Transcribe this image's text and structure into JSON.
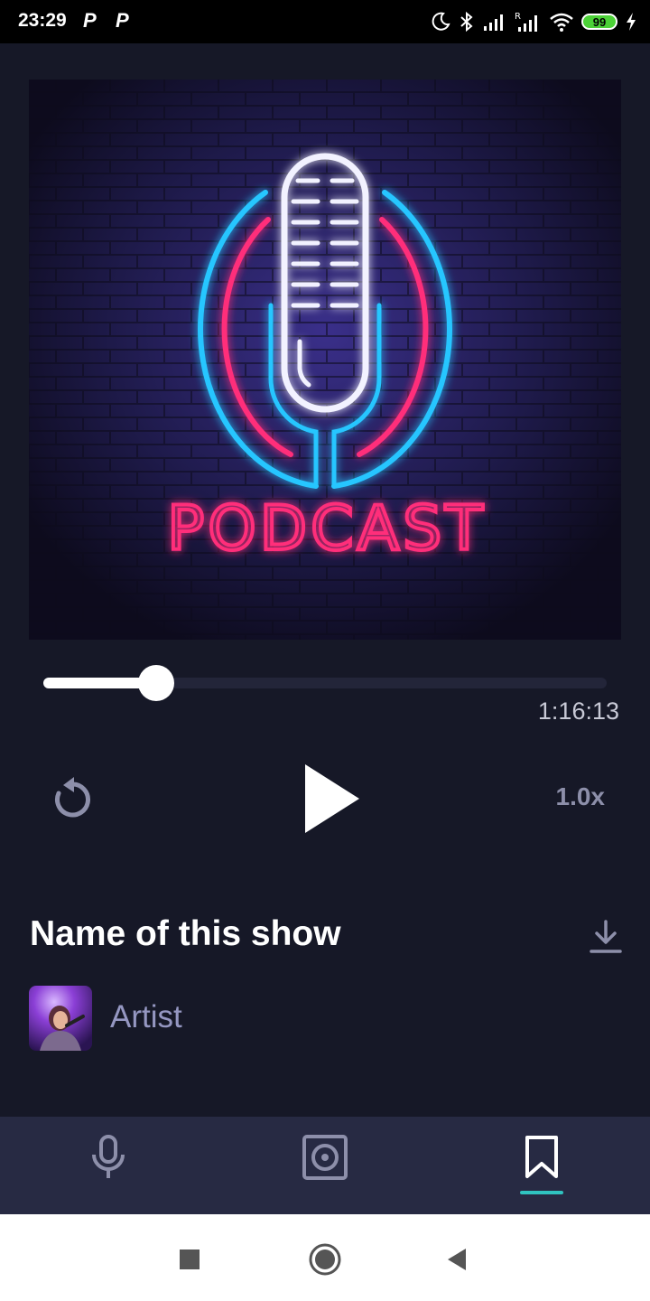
{
  "status_bar": {
    "time": "23:29",
    "app_icons": [
      "P",
      "P"
    ],
    "battery": "99",
    "icons": [
      "moon-icon",
      "bluetooth-icon",
      "signal-icon",
      "signal-roaming-icon",
      "wifi-icon",
      "battery-icon",
      "charging-icon"
    ]
  },
  "player": {
    "cover_text": "PODCAST",
    "progress": 0.2,
    "duration": "1:16:13",
    "speed": "1.0x"
  },
  "show": {
    "title": "Name of this show",
    "artist": "Artist"
  },
  "bottom_nav": {
    "items": [
      "microphone-icon",
      "speaker-icon",
      "bookmark-icon"
    ],
    "active_index": 2,
    "accent": "#30c3c0"
  },
  "colors": {
    "background": "#161827",
    "nav_background": "#272a43",
    "muted_text": "#8d8faa",
    "artist_text": "#9597c2"
  }
}
